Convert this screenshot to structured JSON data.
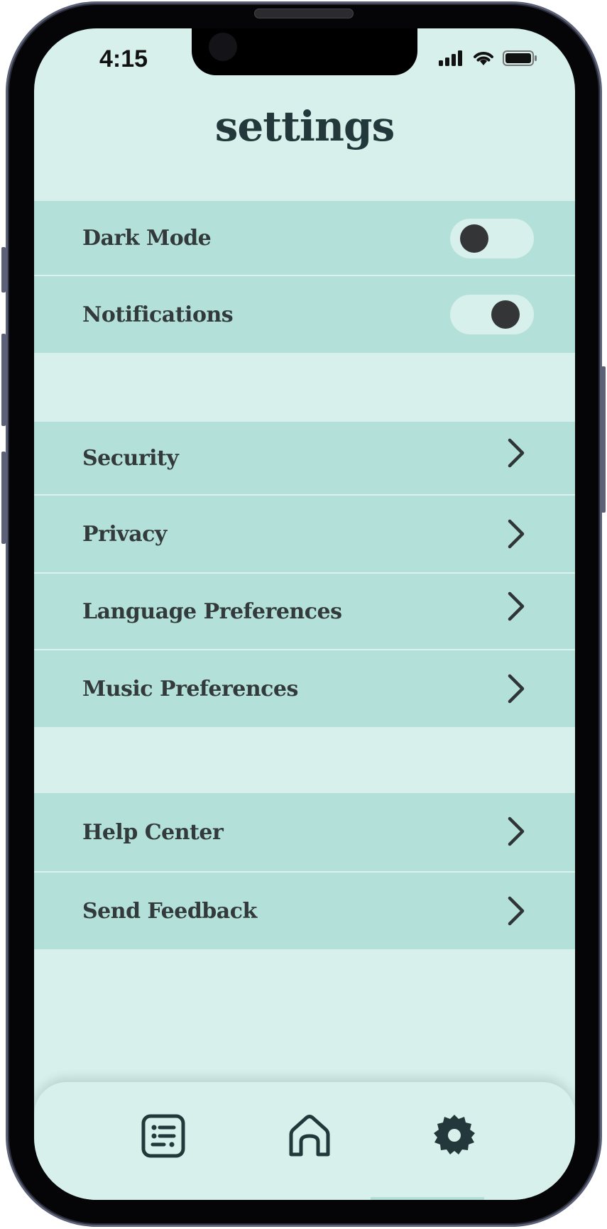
{
  "status_bar": {
    "time": "4:15"
  },
  "header": {
    "title": "settings"
  },
  "toggles": [
    {
      "label": "Dark Mode",
      "state": "off"
    },
    {
      "label": "Notifications",
      "state": "on"
    }
  ],
  "menu_group_1": [
    {
      "label": "Security"
    },
    {
      "label": "Privacy"
    },
    {
      "label": "Language Preferences"
    },
    {
      "label": "Music Preferences"
    }
  ],
  "menu_group_2": [
    {
      "label": "Help Center"
    },
    {
      "label": "Send Feedback"
    }
  ],
  "tab_bar": [
    {
      "icon": "list-icon"
    },
    {
      "icon": "home-icon"
    },
    {
      "icon": "gear-icon",
      "active": true
    }
  ],
  "colors": {
    "background": "#d7f0ec",
    "row_background": "#b3e1da",
    "text": "#333a3b",
    "title": "#22383a"
  }
}
